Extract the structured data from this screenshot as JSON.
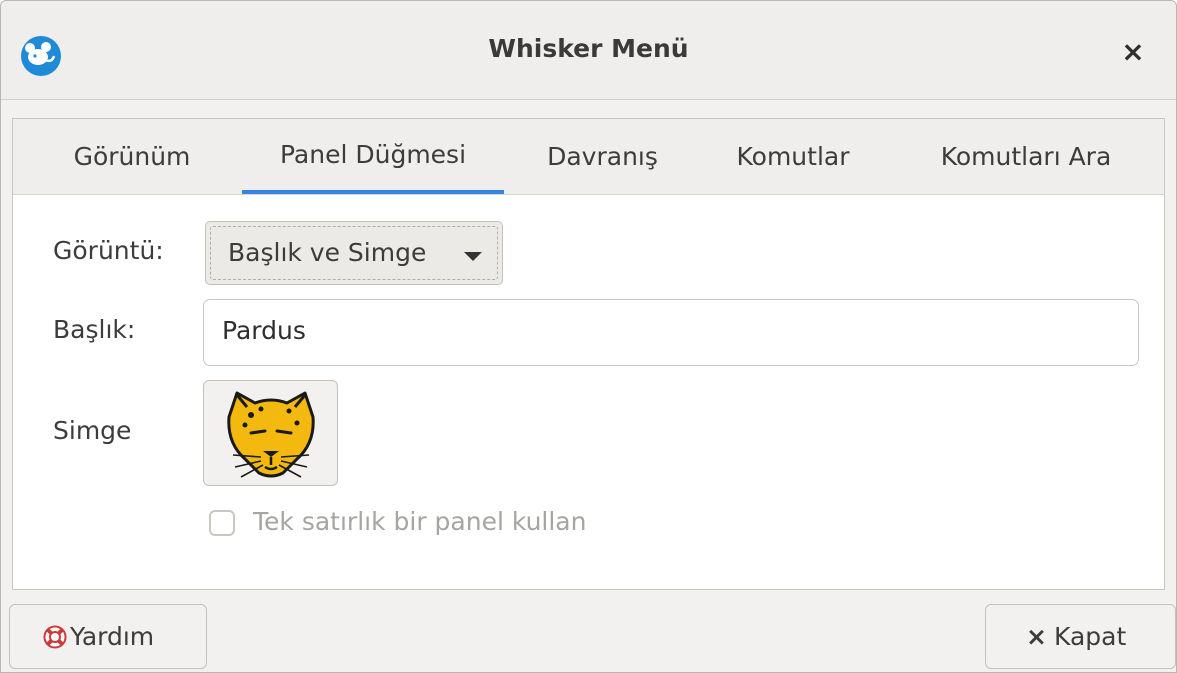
{
  "window": {
    "title": "Whisker Menü",
    "app_icon": "whisker-mouse-icon",
    "close_glyph": "×"
  },
  "tabs": [
    {
      "label": "Görünüm",
      "active": false
    },
    {
      "label": "Panel Düğmesi",
      "active": true
    },
    {
      "label": "Davranış",
      "active": false
    },
    {
      "label": "Komutlar",
      "active": false
    },
    {
      "label": "Komutları Ara",
      "active": false
    }
  ],
  "form": {
    "display_label": "Görüntü:",
    "display_value": "Başlık ve Simge",
    "title_label": "Başlık:",
    "title_value": "Pardus",
    "icon_label": "Simge",
    "icon_name": "pardus-leopard-icon",
    "single_row_label": "Tek satırlık bir panel kullan",
    "single_row_checked": false
  },
  "buttons": {
    "help_label": "Yardım",
    "help_icon": "lifebuoy-icon",
    "close_label": "Kapat",
    "close_glyph": "×"
  },
  "colors": {
    "accent": "#3584e4",
    "app_icon_bg": "#1f8bd8",
    "leopard": "#f3b90e"
  }
}
